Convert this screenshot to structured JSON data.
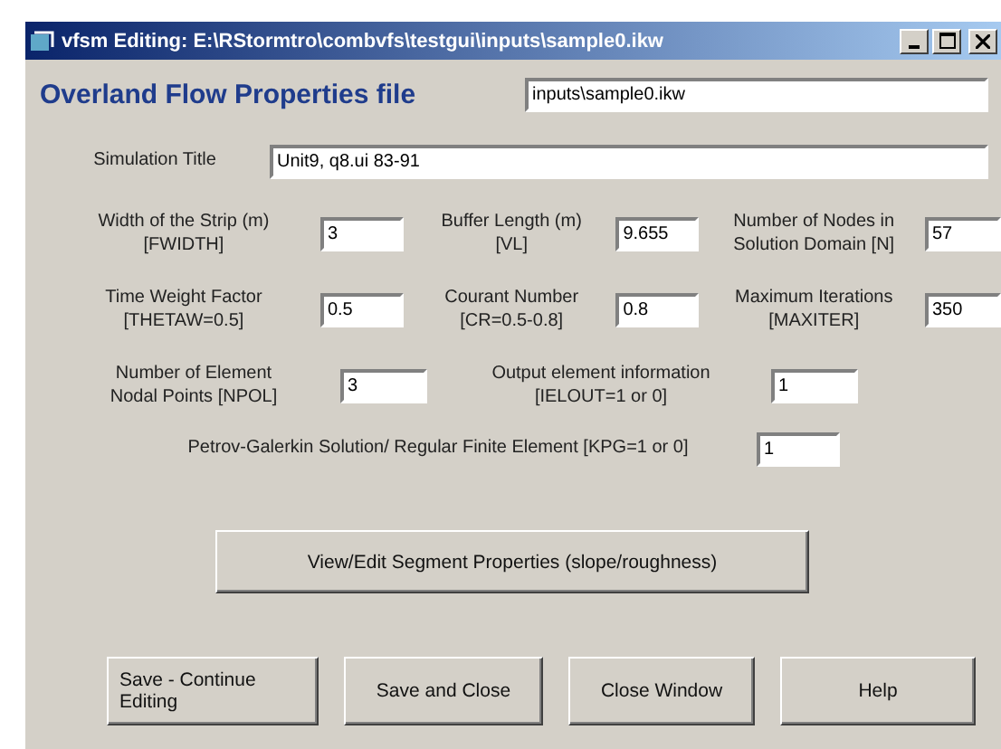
{
  "window": {
    "title": "vfsm Editing: E:\\RStormtro\\combvfs\\testgui\\inputs\\sample0.ikw",
    "controls": [
      {
        "kind": "minimize"
      },
      {
        "kind": "maximize"
      },
      {
        "kind": "close"
      }
    ]
  },
  "heading": "Overland Flow Properties file",
  "file_field": {
    "value": "inputs\\sample0.ikw"
  },
  "simulation_title": {
    "label": "Simulation Title",
    "value": "Unit9, q8.ui 83-91"
  },
  "parameter_rows": [
    [
      {
        "label": "Width of the Strip (m)\n[FWIDTH]",
        "value": "3"
      },
      {
        "label": "Buffer Length (m)\n[VL]",
        "value": "9.655"
      },
      {
        "label": "Number of Nodes in\nSolution Domain [N]",
        "value": "57"
      }
    ],
    [
      {
        "label": "Time Weight Factor\n[THETAW=0.5]",
        "value": "0.5"
      },
      {
        "label": "Courant Number\n[CR=0.5-0.8]",
        "value": "0.8"
      },
      {
        "label": "Maximum Iterations\n[MAXITER]",
        "value": "350"
      }
    ],
    [
      {
        "label": "Number of Element\nNodal Points [NPOL]",
        "value": "3"
      },
      {
        "label": "Output element information\n[IELOUT=1 or 0]",
        "value": "1"
      }
    ]
  ],
  "kpg": {
    "label": "Petrov-Galerkin Solution/ Regular Finite Element [KPG=1 or 0]",
    "value": "1"
  },
  "segment_button": "View/Edit Segment Properties (slope/roughness)",
  "buttons": [
    "Save - Continue\nEditing",
    "Save and Close",
    "Close Window",
    "Help"
  ]
}
